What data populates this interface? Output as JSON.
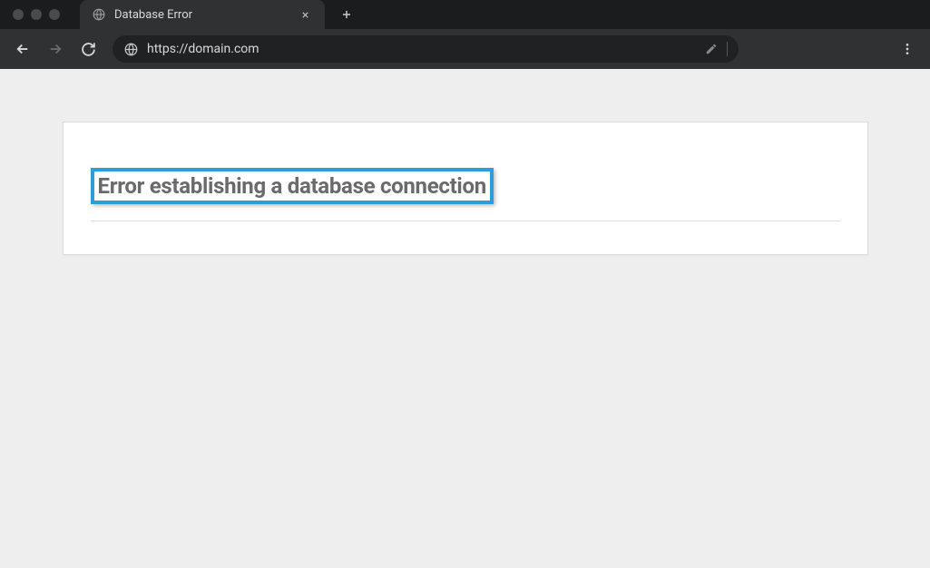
{
  "tab": {
    "title": "Database Error"
  },
  "address": {
    "url": "https://domain.com"
  },
  "page": {
    "error_heading": "Error establishing a database connection"
  }
}
